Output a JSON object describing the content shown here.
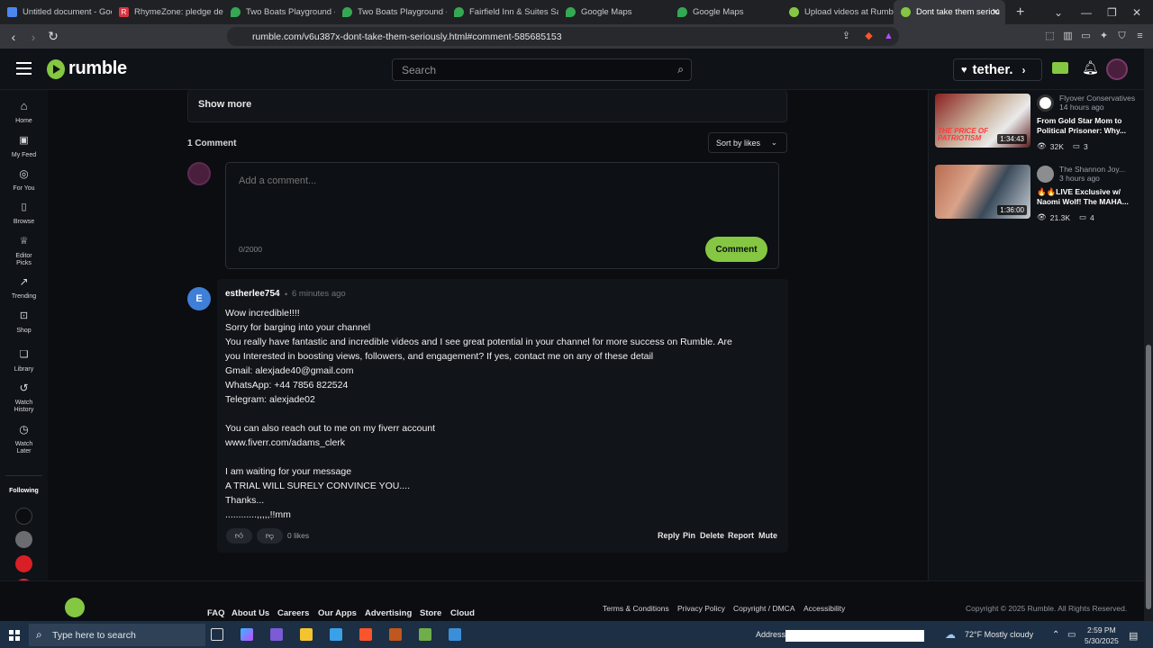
{
  "browser": {
    "tabs": [
      {
        "label": "Untitled document - Goog",
        "color": "#4b87f0"
      },
      {
        "label": "RhymeZone: pledge defin",
        "color": "#d8343f"
      },
      {
        "label": "Two Boats Playground - G",
        "color": "#34a853"
      },
      {
        "label": "Two Boats Playground - G",
        "color": "#34a853"
      },
      {
        "label": "Fairfield Inn & Suites San",
        "color": "#34a853"
      },
      {
        "label": "Google Maps",
        "color": "#34a853"
      },
      {
        "label": "Google Maps",
        "color": "#34a853"
      },
      {
        "label": "Upload videos at Rumble",
        "color": "#85c742"
      },
      {
        "label": "Dont take them seriou",
        "color": "#85c742"
      }
    ],
    "url": "rumble.com/v6u387x-dont-take-them-seriously.html#comment-585685153"
  },
  "header": {
    "logo_text": "rumble",
    "search_placeholder": "Search",
    "tether_label": "tether."
  },
  "nav": [
    {
      "label": "Home"
    },
    {
      "label": "My Feed"
    },
    {
      "label": "For You"
    },
    {
      "label": "Browse"
    },
    {
      "label": "Editor",
      "label2": "Picks"
    },
    {
      "label": "Trending"
    },
    {
      "label": "Shop"
    },
    {
      "label": "Library"
    },
    {
      "label": "Watch",
      "label2": "History"
    },
    {
      "label": "Watch",
      "label2": "Later"
    }
  ],
  "following_label": "Following",
  "show_more": "Show more",
  "comments": {
    "count_label": "1 Comment",
    "sort_label": "Sort by likes",
    "placeholder": "Add a comment...",
    "char_count": "0/2000",
    "submit_label": "Comment",
    "item": {
      "avatar_letter": "E",
      "username": "estherlee754",
      "time": "6 minutes ago",
      "lines": [
        "Wow incredible!!!!",
        "Sorry for barging into your channel",
        "You really have fantastic and incredible videos and I see great potential in your channel for more success on Rumble. Are",
        "you Interested in boosting views, followers, and engagement? If yes, contact me on any of these detail",
        "Gmail: alexjade40@gmail.com",
        "WhatsApp: +44 7856 822524",
        "Telegram: alexjade02",
        "",
        "You can also reach out to me on my fiverr account",
        "www.fiverr.com/adams_clerk",
        "",
        "I am waiting for your message",
        "A TRIAL WILL SURELY CONVINCE YOU....",
        "Thanks...",
        "............,,,,,!!mm"
      ],
      "likes": "0 likes",
      "actions": [
        "Reply",
        "Pin",
        "Delete",
        "Report",
        "Mute"
      ]
    }
  },
  "related": [
    {
      "channel": "Flyover Conservatives",
      "time": "14 hours ago",
      "title1": "From Gold Star Mom to",
      "title2": "Political Prisoner: Why...",
      "views": "32K",
      "comments": "3",
      "duration": "1:34:43",
      "thumb_text": "THE PRICE OF PATRIOTISM"
    },
    {
      "channel": "The Shannon Joy...",
      "time": "3 hours ago",
      "title1": "🔥🔥LIVE Exclusive w/",
      "title2": "Naomi Wolf! The MAHA...",
      "views": "21.3K",
      "comments": "4",
      "duration": "1:36:00",
      "thumb_text": ""
    }
  ],
  "footer": {
    "links": [
      "FAQ",
      "About Us",
      "Careers",
      "Our Apps",
      "Advertising",
      "Store",
      "Cloud"
    ],
    "legal": [
      "Terms & Conditions",
      "Privacy Policy",
      "Copyright / DMCA",
      "Accessibility"
    ],
    "copyright": "Copyright © 2025 Rumble. All Rights Reserved."
  },
  "taskbar": {
    "search_placeholder": "Type here to search",
    "address_label": "Address",
    "weather": "72°F  Mostly cloudy",
    "time": "2:59 PM",
    "date": "5/30/2025"
  },
  "colors": {
    "brand": "#85c742",
    "accent_blue": "#3f7fd8"
  }
}
